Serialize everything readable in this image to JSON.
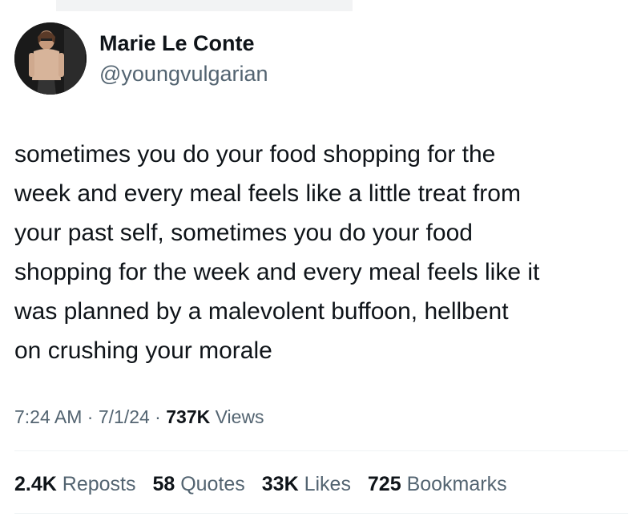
{
  "author": {
    "name": "Marie Le Conte",
    "handle": "@youngvulgarian"
  },
  "tweet": {
    "lines": [
      "sometimes you do your food shopping for the",
      "week and every meal feels like a little treat from",
      "your past self, sometimes you do your food",
      "shopping for the week and every meal feels like it",
      "was planned by a malevolent buffoon, hellbent",
      "on crushing your morale"
    ]
  },
  "meta": {
    "time": "7:24 AM",
    "sep1": " · ",
    "date": "7/1/24",
    "sep2": " · ",
    "views_count": "737K",
    "views_label": " Views"
  },
  "stats": [
    {
      "count": "2.4K",
      "label": " Reposts"
    },
    {
      "count": "58",
      "label": " Quotes"
    },
    {
      "count": "33K",
      "label": " Likes"
    },
    {
      "count": "725",
      "label": " Bookmarks"
    }
  ]
}
